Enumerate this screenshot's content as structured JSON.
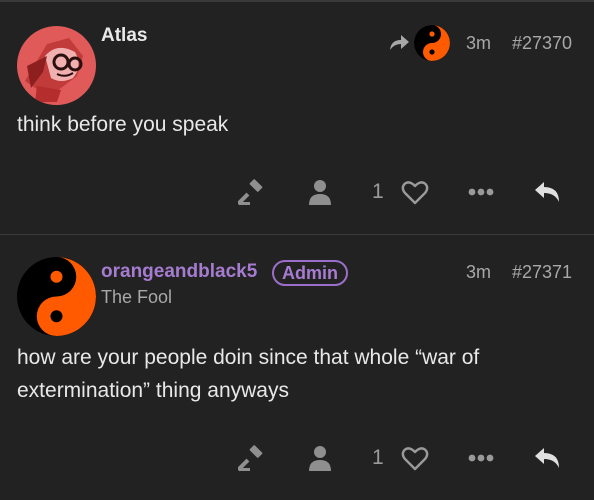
{
  "posts": [
    {
      "author": "Atlas",
      "time": "3m",
      "number": "#27370",
      "body": "think before you speak",
      "likes": "1",
      "reply_to": {
        "avatar": "yin-yang-avatar"
      }
    },
    {
      "author": "orangeandblack5",
      "badge": "Admin",
      "title": "The Fool",
      "time": "3m",
      "number": "#27371",
      "body": "how are your people doin since that whole “war of extermination” thing anyways",
      "likes": "1"
    }
  ],
  "icons": {
    "moderate": "gavel-icon",
    "user": "user-icon",
    "like": "heart-icon",
    "more": "ellipsis-icon",
    "reply": "reply-icon",
    "reply_to": "share-arrow-icon"
  },
  "colors": {
    "background": "#222222",
    "admin_purple": "#a67cd1",
    "muted": "#a8a8a8",
    "yin_orange": "#ff5a00",
    "avatar_red": "#e05a5a"
  }
}
